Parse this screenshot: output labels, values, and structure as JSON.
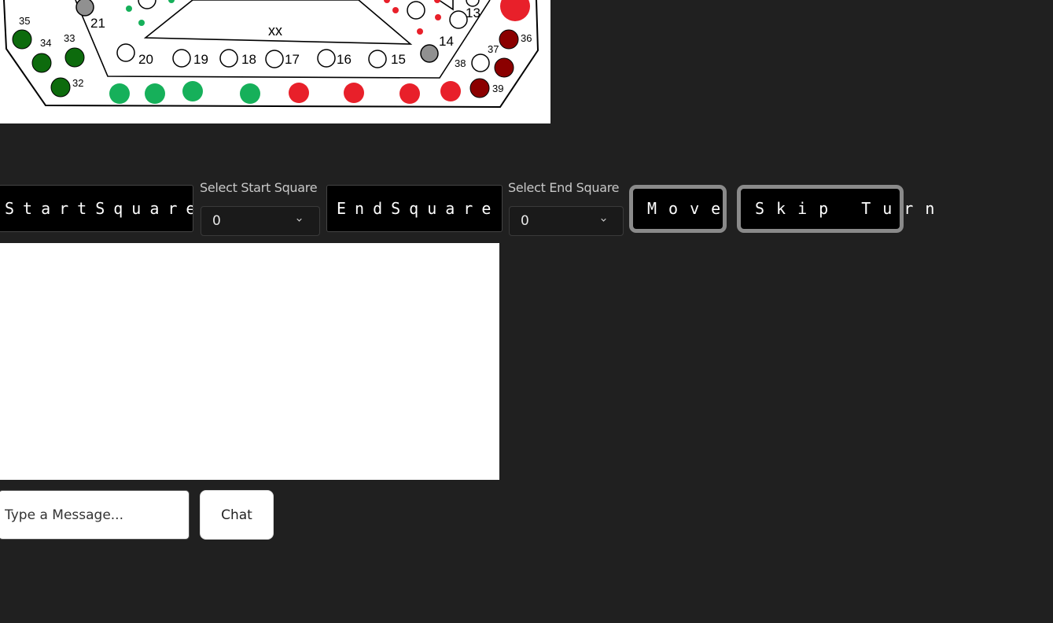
{
  "board": {
    "center_label": "xx",
    "square_labels": [
      "13",
      "14",
      "15",
      "16",
      "17",
      "18",
      "19",
      "20",
      "21"
    ],
    "corner_labels": [
      "35",
      "34",
      "33",
      "32",
      "36",
      "37",
      "38",
      "39"
    ],
    "colors": {
      "green": "#16b05a",
      "dark_green": "#0d6b0d",
      "red": "#e8202a",
      "dark_red": "#8b0000",
      "gray": "#909090"
    }
  },
  "controls": {
    "start_label": "StartSquare:",
    "start_select_caption": "Select Start Square",
    "start_select_value": "0",
    "end_label": "EndSquare:",
    "end_select_caption": "Select End Square",
    "end_select_value": "0",
    "move_button": "Move",
    "skip_button": "Skip Turn"
  },
  "chat": {
    "input_placeholder": "Type a Message...",
    "send_button": "Chat"
  }
}
